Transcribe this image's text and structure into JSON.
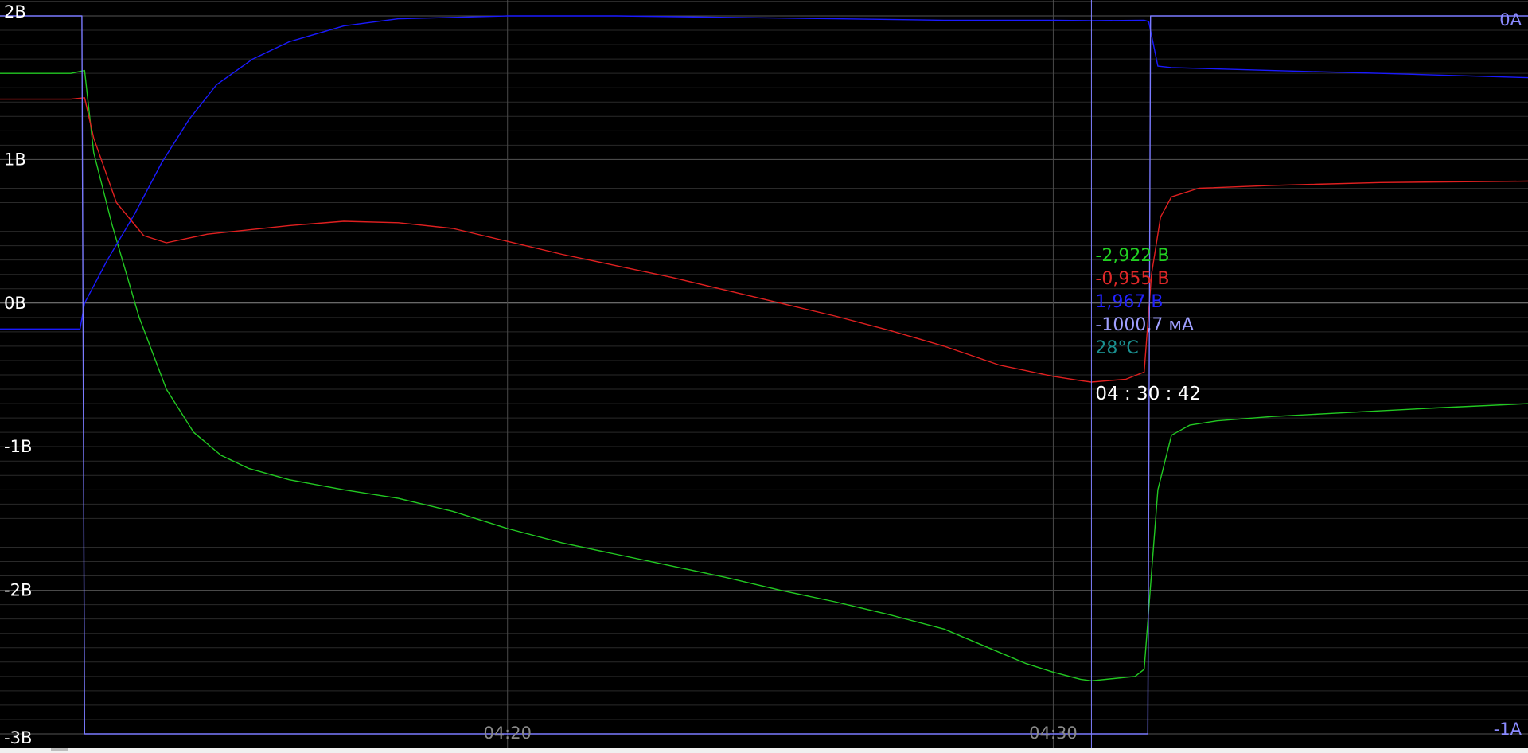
{
  "chart_data": {
    "type": "line",
    "title": "",
    "grid": true,
    "x_unit": "time",
    "x_range": [
      "04:10:42",
      "04:38:42"
    ],
    "x_ticks": [
      {
        "t": "04:20:00",
        "label": "04:20"
      },
      {
        "t": "04:30:00",
        "label": "04:30"
      }
    ],
    "y_left": {
      "range": [
        -3,
        2
      ],
      "ticks": [
        {
          "v": 2,
          "label": "2В"
        },
        {
          "v": 1,
          "label": "1В"
        },
        {
          "v": 0,
          "label": "0В"
        },
        {
          "v": -1,
          "label": "-1В"
        },
        {
          "v": -2,
          "label": "-2В"
        },
        {
          "v": -3,
          "label": "-3В"
        }
      ]
    },
    "y_right": {
      "range": [
        -1,
        0
      ],
      "ticks": [
        {
          "v": 0,
          "label": "0A"
        },
        {
          "v": -1,
          "label": "-1A"
        }
      ]
    },
    "series": [
      {
        "color": "#22c822",
        "axis": "left",
        "points": [
          [
            "04:10:42",
            1.6
          ],
          [
            "04:12:00",
            1.6
          ],
          [
            "04:12:15",
            1.62
          ],
          [
            "04:12:25",
            1.05
          ],
          [
            "04:12:45",
            0.55
          ],
          [
            "04:13:15",
            -0.1
          ],
          [
            "04:13:45",
            -0.6
          ],
          [
            "04:14:15",
            -0.9
          ],
          [
            "04:14:45",
            -1.06
          ],
          [
            "04:15:15",
            -1.15
          ],
          [
            "04:16:00",
            -1.23
          ],
          [
            "04:17:00",
            -1.3
          ],
          [
            "04:18:00",
            -1.36
          ],
          [
            "04:19:00",
            -1.45
          ],
          [
            "04:20:00",
            -1.57
          ],
          [
            "04:21:00",
            -1.67
          ],
          [
            "04:22:00",
            -1.75
          ],
          [
            "04:23:00",
            -1.83
          ],
          [
            "04:24:00",
            -1.91
          ],
          [
            "04:25:00",
            -2.0
          ],
          [
            "04:26:00",
            -2.08
          ],
          [
            "04:27:00",
            -2.17
          ],
          [
            "04:28:00",
            -2.27
          ],
          [
            "04:29:00",
            -2.43
          ],
          [
            "04:29:30",
            -2.51
          ],
          [
            "04:30:00",
            -2.57
          ],
          [
            "04:30:30",
            -2.62
          ],
          [
            "04:30:42",
            -2.63
          ],
          [
            "04:31:30",
            -2.6
          ],
          [
            "04:31:40",
            -2.55
          ],
          [
            "04:31:55",
            -1.3
          ],
          [
            "04:32:10",
            -0.92
          ],
          [
            "04:32:30",
            -0.85
          ],
          [
            "04:33:00",
            -0.82
          ],
          [
            "04:34:00",
            -0.79
          ],
          [
            "04:35:00",
            -0.77
          ],
          [
            "04:36:00",
            -0.75
          ],
          [
            "04:37:00",
            -0.73
          ],
          [
            "04:38:42",
            -0.7
          ]
        ]
      },
      {
        "color": "#e02020",
        "axis": "left",
        "points": [
          [
            "04:10:42",
            1.42
          ],
          [
            "04:12:00",
            1.42
          ],
          [
            "04:12:15",
            1.43
          ],
          [
            "04:12:25",
            1.15
          ],
          [
            "04:12:50",
            0.7
          ],
          [
            "04:13:20",
            0.47
          ],
          [
            "04:13:45",
            0.42
          ],
          [
            "04:14:30",
            0.48
          ],
          [
            "04:16:00",
            0.54
          ],
          [
            "04:17:00",
            0.57
          ],
          [
            "04:18:00",
            0.56
          ],
          [
            "04:19:00",
            0.52
          ],
          [
            "04:20:00",
            0.43
          ],
          [
            "04:21:00",
            0.34
          ],
          [
            "04:22:00",
            0.26
          ],
          [
            "04:23:00",
            0.18
          ],
          [
            "04:24:00",
            0.09
          ],
          [
            "04:25:00",
            0.0
          ],
          [
            "04:26:00",
            -0.09
          ],
          [
            "04:27:00",
            -0.19
          ],
          [
            "04:28:00",
            -0.3
          ],
          [
            "04:29:00",
            -0.43
          ],
          [
            "04:30:00",
            -0.51
          ],
          [
            "04:30:30",
            -0.54
          ],
          [
            "04:30:42",
            -0.55
          ],
          [
            "04:31:20",
            -0.53
          ],
          [
            "04:31:40",
            -0.48
          ],
          [
            "04:31:48",
            0.2
          ],
          [
            "04:31:58",
            0.6
          ],
          [
            "04:32:10",
            0.74
          ],
          [
            "04:32:40",
            0.8
          ],
          [
            "04:34:00",
            0.82
          ],
          [
            "04:36:00",
            0.84
          ],
          [
            "04:38:42",
            0.85
          ]
        ]
      },
      {
        "color": "#1a1aff",
        "axis": "left",
        "points": [
          [
            "04:10:42",
            -0.18
          ],
          [
            "04:12:00",
            -0.18
          ],
          [
            "04:12:10",
            -0.18
          ],
          [
            "04:12:15",
            0.0
          ],
          [
            "04:12:40",
            0.3
          ],
          [
            "04:13:10",
            0.62
          ],
          [
            "04:13:40",
            0.98
          ],
          [
            "04:14:10",
            1.28
          ],
          [
            "04:14:40",
            1.52
          ],
          [
            "04:15:20",
            1.7
          ],
          [
            "04:16:00",
            1.82
          ],
          [
            "04:17:00",
            1.93
          ],
          [
            "04:18:00",
            1.98
          ],
          [
            "04:20:00",
            2.0
          ],
          [
            "04:22:00",
            2.0
          ],
          [
            "04:24:00",
            1.99
          ],
          [
            "04:26:00",
            1.98
          ],
          [
            "04:28:00",
            1.97
          ],
          [
            "04:30:00",
            1.97
          ],
          [
            "04:30:42",
            1.967
          ],
          [
            "04:31:40",
            1.97
          ],
          [
            "04:31:45",
            1.96
          ],
          [
            "04:31:55",
            1.65
          ],
          [
            "04:32:10",
            1.64
          ],
          [
            "04:34:00",
            1.62
          ],
          [
            "04:36:00",
            1.6
          ],
          [
            "04:38:42",
            1.57
          ]
        ]
      },
      {
        "color": "#7a7aff",
        "axis": "right",
        "points": [
          [
            "04:10:42",
            0.0
          ],
          [
            "04:12:12",
            0.0
          ],
          [
            "04:12:15",
            -1.0
          ],
          [
            "04:31:44",
            -1.0
          ],
          [
            "04:31:47",
            0.0
          ],
          [
            "04:38:42",
            0.0
          ]
        ]
      }
    ],
    "cursor": {
      "time": "04:30:42",
      "time_label": "04 : 30 : 42",
      "readouts": [
        {
          "text": "-2,922 В",
          "color": "#22d022"
        },
        {
          "text": "-0,955 В",
          "color": "#e02828"
        },
        {
          "text": "1,967 В",
          "color": "#2222ff"
        },
        {
          "text": "-1000,7 мА",
          "color": "#a0a0ff"
        },
        {
          "text": "28°C",
          "color": "#1a8f8f"
        }
      ]
    }
  }
}
